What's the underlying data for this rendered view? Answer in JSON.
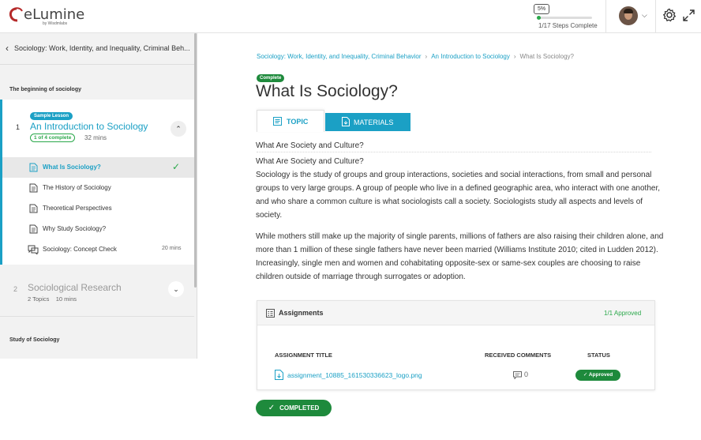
{
  "header": {
    "logo_text": "eLumine",
    "logo_sub": "by Wisdmlabs",
    "progress_badge": "5%",
    "progress_value": 5,
    "progress_text": "1/17 Steps Complete",
    "colors": {
      "accent": "#1ba0c5",
      "success": "#2aa84a",
      "success_dark": "#1e8a3c"
    }
  },
  "sidebar": {
    "course_title": "Sociology: Work, Identity, and Inequality, Criminal Beh...",
    "section1": "The beginning of sociology",
    "lesson1": {
      "number": "1",
      "badge": "Sample Lesson",
      "title": "An Introduction to Sociology",
      "progress": "1 of 4 complete",
      "mins": "32 mins",
      "topics": [
        {
          "label": "What Is Sociology?",
          "icon": "document-icon",
          "active": true,
          "done": true,
          "mins": ""
        },
        {
          "label": "The History of Sociology",
          "icon": "document-icon",
          "active": false,
          "done": false,
          "mins": ""
        },
        {
          "label": "Theoretical Perspectives",
          "icon": "document-icon",
          "active": false,
          "done": false,
          "mins": ""
        },
        {
          "label": "Why Study Sociology?",
          "icon": "document-icon",
          "active": false,
          "done": false,
          "mins": ""
        },
        {
          "label": "Sociology: Concept Check",
          "icon": "quiz-icon",
          "active": false,
          "done": false,
          "mins": "20 mins"
        }
      ]
    },
    "lesson2": {
      "number": "2",
      "title": "Sociological Research",
      "topics": "2 Topics",
      "mins": "10 mins"
    },
    "section2": "Study of Sociology"
  },
  "main": {
    "breadcrumb": {
      "course": "Sociology: Work, Identity, and Inequality, Criminal Behavior",
      "lesson": "An Introduction to Sociology",
      "current": "What Is Sociology?"
    },
    "status": "Complete",
    "title": "What Is Sociology?",
    "tabs": {
      "topic": "TOPIC",
      "materials": "MATERIALS"
    },
    "content": {
      "heading1": "What Are Society and Culture?",
      "heading2": "What Are Society and Culture?",
      "para1": "Sociology is the study of groups and group interactions, societies and social interactions, from small and personal groups to very large groups. A group of people who live in a defined geographic area, who interact with one another, and who share a common culture is what sociologists call a society. Sociologists study all aspects and levels of society.",
      "para2": "While mothers still make up the majority of single parents, millions of fathers are also raising their children alone, and more than 1 million of these single fathers have never been married (Williams Institute 2010; cited in Ludden 2012). Increasingly, single men and women and cohabitating opposite-sex or same-sex couples are choosing to raise children outside of marriage through surrogates or adoption."
    },
    "assignments": {
      "title": "Assignments",
      "count": "1/1 Approved",
      "col_title": "ASSIGNMENT TITLE",
      "col_comments": "RECEIVED COMMENTS",
      "col_status": "STATUS",
      "file": "assignment_10885_161530336623_logo.png",
      "comments": "0",
      "status": "Approved"
    },
    "completed_button": "COMPLETED"
  }
}
